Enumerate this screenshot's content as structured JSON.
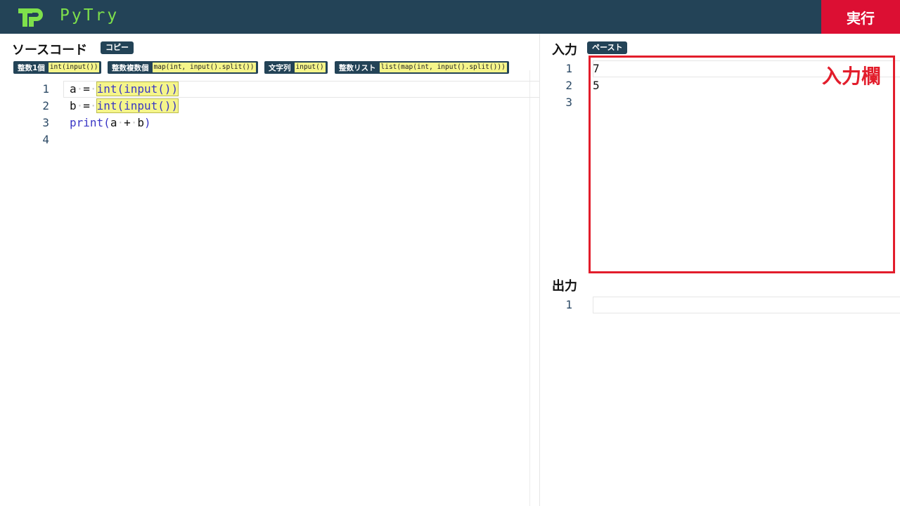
{
  "app": {
    "name": "PyTry",
    "run_label": "実行"
  },
  "source": {
    "title": "ソースコード",
    "copy_label": "コピー",
    "snippets": [
      {
        "label": "整数1個",
        "code": "int(input())"
      },
      {
        "label": "整数複数個",
        "code": "map(int, input().split())"
      },
      {
        "label": "文字列",
        "code": "input()"
      },
      {
        "label": "整数リスト",
        "code": "list(map(int, input().split()))"
      }
    ],
    "line_numbers": [
      "1",
      "2",
      "3",
      "4"
    ],
    "code_lines": [
      {
        "var": "a",
        "op": "=",
        "call": "int(input())"
      },
      {
        "var": "b",
        "op": "=",
        "call": "int(input())"
      },
      {
        "fn": "print",
        "args_open": "(",
        "a": "a",
        "plus": "+",
        "b": "b",
        "args_close": ")"
      }
    ]
  },
  "input_panel": {
    "title": "入力",
    "paste_label": "ペースト",
    "line_numbers": [
      "1",
      "2",
      "3"
    ],
    "lines": [
      "7",
      "5",
      ""
    ],
    "annotation": "入力欄",
    "annotation_color": "#e21d2b"
  },
  "output_panel": {
    "title": "出力",
    "line_numbers": [
      "1"
    ],
    "lines": [
      ""
    ]
  },
  "colors": {
    "header": "#234357",
    "brand": "#7ee04b",
    "run": "#dc0f33",
    "highlight": "#f5f58a"
  }
}
